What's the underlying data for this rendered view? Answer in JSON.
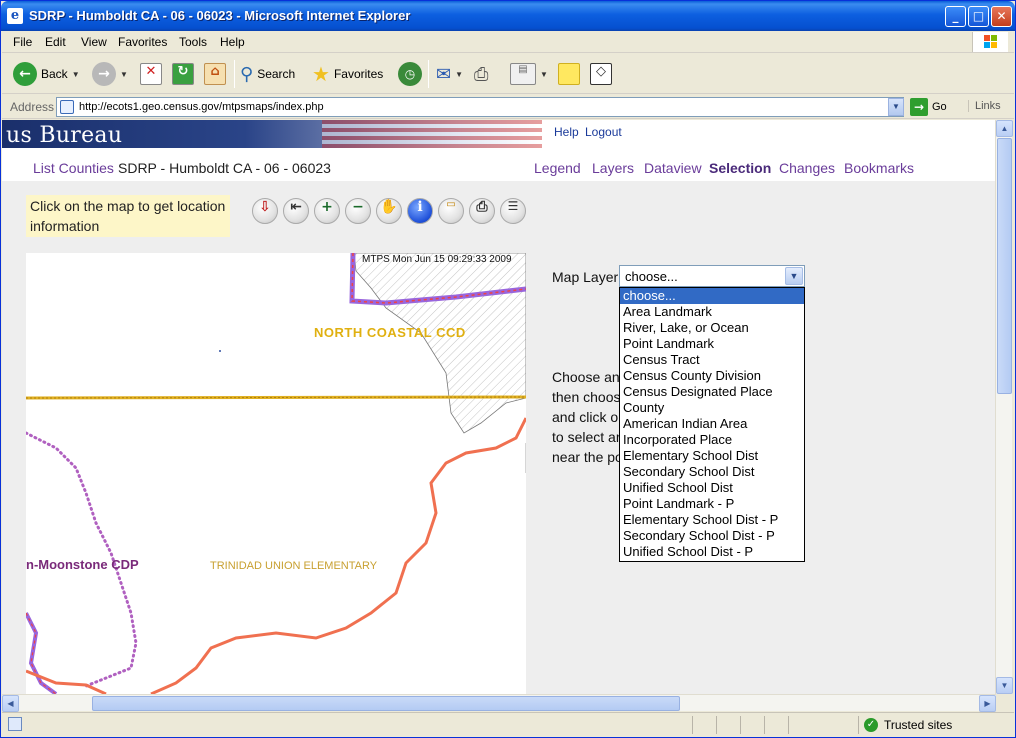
{
  "window": {
    "title": "SDRP - Humboldt CA - 06 - 06023 - Microsoft Internet Explorer"
  },
  "menubar": {
    "items": [
      "File",
      "Edit",
      "View",
      "Favorites",
      "Tools",
      "Help"
    ]
  },
  "toolbar": {
    "back_label": "Back",
    "search_label": "Search",
    "favorites_label": "Favorites"
  },
  "addressbar": {
    "label": "Address",
    "url": "http://ecots1.geo.census.gov/mtpsmaps/index.php",
    "go_label": "Go",
    "links_label": "Links"
  },
  "page": {
    "banner_text": "us Bureau",
    "help_label": "Help",
    "logout_label": "Logout",
    "list_counties_label": "List Counties",
    "county_title": "SDRP - Humboldt CA - 06 - 06023",
    "nav": [
      "Legend",
      "Layers",
      "Dataview",
      "Selection",
      "Changes",
      "Bookmarks"
    ],
    "active_nav": "Selection",
    "hint_line1": "Click on the map to get location",
    "hint_line2": "information",
    "map_tools": [
      "zoom-to-extent-icon",
      "back-arrow-icon",
      "zoom-in-icon",
      "zoom-out-icon",
      "pan-hand-icon",
      "info-icon",
      "measure-icon",
      "print-icon",
      "layers-icon"
    ]
  },
  "map": {
    "timestamp": "MTPS Mon Jun 15 09:29:33 2009",
    "label_ccd": "NORTH COASTAL CCD",
    "label_cdp": "n-Moonstone CDP",
    "label_school": "TRINIDAD UNION ELEMENTARY"
  },
  "selection_panel": {
    "layer_label": "Map Layer",
    "selected_value": "choose...",
    "options": [
      "choose...",
      "Area Landmark",
      "River, Lake, or Ocean",
      "Point Landmark",
      "Census Tract",
      "Census County Division",
      "Census Designated Place",
      "County",
      "American Indian Area",
      "Incorporated Place",
      "Elementary School Dist",
      "Secondary School Dist",
      "Unified School Dist",
      "Point Landmark - P",
      "Elementary School Dist - P",
      "Secondary School Dist - P",
      "Unified School Dist - P"
    ],
    "instructions": [
      "Choose an",
      "then choos",
      "and click o",
      "to select ar",
      "near the po"
    ]
  },
  "statusbar": {
    "zone_label": "Trusted sites"
  },
  "colors": {
    "nav_link": "#6a3c9a",
    "ccd_label": "#e0b010",
    "cdp_label": "#7a2a7a",
    "school_label": "#c8a030",
    "boundary_orange": "#f07050",
    "boundary_purple": "#b060c0",
    "dropdown_highlight": "#316ac5"
  }
}
